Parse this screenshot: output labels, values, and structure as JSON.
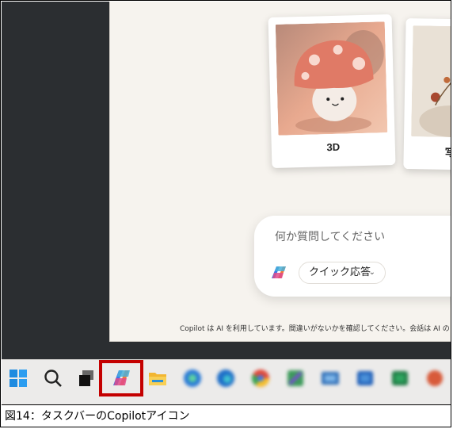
{
  "cards": [
    {
      "caption": "3D"
    },
    {
      "caption": "写"
    }
  ],
  "composer": {
    "placeholder": "何か質問してください",
    "mode_label": "クイック応答"
  },
  "disclaimer": "Copilot は AI を利用しています。間違いがないかを確認してください。会話は AI のトレーニ",
  "taskbar": {
    "icons": [
      "windows-start-icon",
      "search-icon",
      "task-view-icon",
      "copilot-icon",
      "file-explorer-icon",
      "edge-icon",
      "edge-icon",
      "chrome-icon",
      "app-icon",
      "app-icon",
      "app-icon",
      "app-icon",
      "app-icon"
    ],
    "highlight_color": "#c40000"
  },
  "caption": "図14：タスクバーのCopilotアイコン"
}
